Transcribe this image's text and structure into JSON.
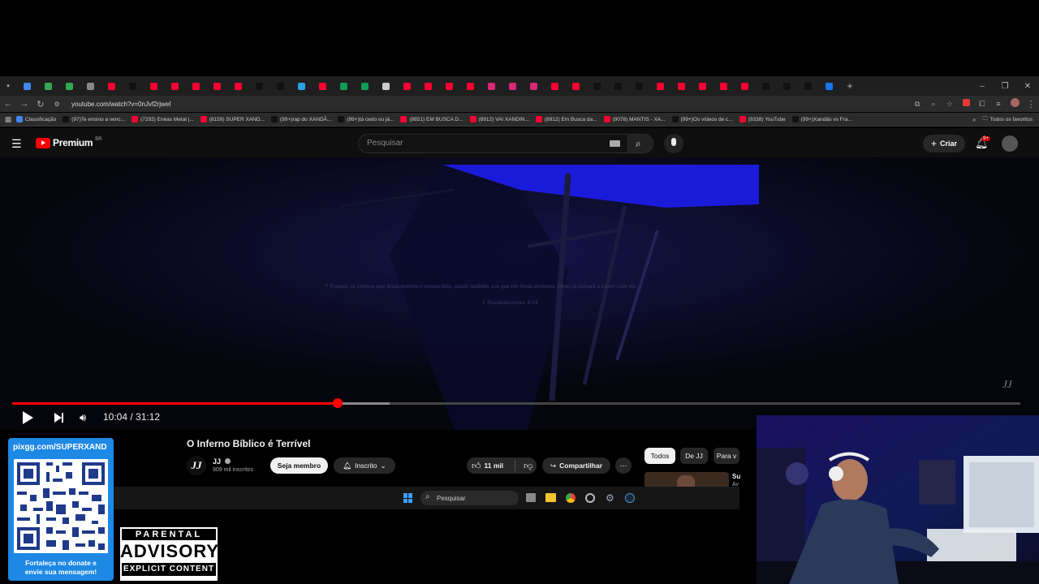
{
  "browser": {
    "url": "youtube.com/watch?v=0nJvf2rjweI",
    "tab_count_icons": [
      "i",
      "t",
      "t",
      "E",
      "(",
      "x",
      "C",
      "(",
      "(",
      "'",
      "/",
      "(",
      "I",
      "(",
      "(",
      "T",
      "I",
      "K",
      "S",
      "\\",
      "(",
      ".",
      "/",
      "E",
      "I",
      "F",
      "I",
      "I",
      "'",
      "(",
      "(",
      "(",
      "Y",
      "(",
      "Y",
      "(",
      "Y",
      "(",
      "(",
      "(",
      "F",
      "I"
    ],
    "bookmarks": [
      {
        "label": "Classificação",
        "color": "#4285f4"
      },
      {
        "label": "(97)Te ensino a venc...",
        "color": "#111111"
      },
      {
        "label": "(7292) Enéas Metal |...",
        "color": "#ff0033"
      },
      {
        "label": "(8159) SUPER XAND...",
        "color": "#ff0033"
      },
      {
        "label": "(99+)rap do XANDÃ...",
        "color": "#111111"
      },
      {
        "label": "(99+)tá cedo ou já...",
        "color": "#111111"
      },
      {
        "label": "(8851) EM BUSCA D...",
        "color": "#ff0033"
      },
      {
        "label": "(8912) VAI XANDIN...",
        "color": "#ff0033"
      },
      {
        "label": "(8912) Em Busca da...",
        "color": "#ff0033"
      },
      {
        "label": "(9078) MANTIS - XA...",
        "color": "#ff0033"
      },
      {
        "label": "(99+)Os vídeos de c...",
        "color": "#111111"
      },
      {
        "label": "(9338) YouTube",
        "color": "#ff0033"
      },
      {
        "label": "(99+)Xandão vs Fra...",
        "color": "#111111"
      }
    ],
    "all_bookmarks": "Todos os favoritos"
  },
  "youtube": {
    "logo_text": "Premium",
    "region": "BR",
    "search_placeholder": "Pesquisar",
    "create_label": "Criar",
    "notifications_badge": "9+"
  },
  "video": {
    "verse_text": "¹⁴ Porque, se cremos que Jesus morreu e ressuscitou, assim também aos que em Jesus dormem, Deus os tornará a trazer com ele.",
    "verse_ref": "1 Tessalonicenses 4:14",
    "watermark": "JJ",
    "current_time": "10:04",
    "duration": "31:12",
    "timecode": "10:04 / 31:12",
    "progress_fraction": 0.3226,
    "buffer_fraction": 0.3744
  },
  "below_video": {
    "title": "O Inferno Bíblico é Terrível",
    "channel_name": "JJ",
    "channel_avatar": "JJ",
    "subscribers": "909 mil inscritos",
    "join_label": "Seja membro",
    "subscribed_label": "Inscrito",
    "likes": "11 mil",
    "share_label": "Compartilhar",
    "chips": [
      "Todos",
      "De JJ",
      "Para v"
    ],
    "suggested_title_partial": "Su",
    "suggested_sub_partial": "Av"
  },
  "taskbar": {
    "search_placeholder": "Pesquisar"
  },
  "overlay": {
    "qr_url": "pixgg.com/SUPERXAND",
    "qr_caption_line1": "Fortaleça no donate e",
    "qr_caption_line2": "envie sua mensagem!",
    "advisory_top": "PARENTAL",
    "advisory_mid": "ADVISORY",
    "advisory_bottom": "EXPLICIT CONTENT"
  },
  "colors": {
    "accent_red": "#ff0000",
    "qr_blue": "#1e88e5",
    "video_blue": "#1a1aff"
  }
}
